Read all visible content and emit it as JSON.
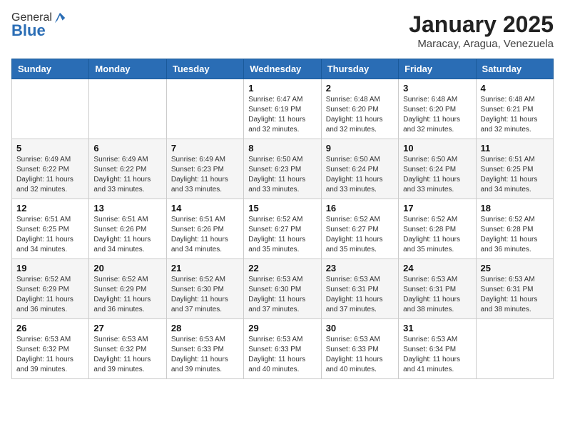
{
  "header": {
    "logo_general": "General",
    "logo_blue": "Blue",
    "title": "January 2025",
    "subtitle": "Maracay, Aragua, Venezuela"
  },
  "days_of_week": [
    "Sunday",
    "Monday",
    "Tuesday",
    "Wednesday",
    "Thursday",
    "Friday",
    "Saturday"
  ],
  "weeks": [
    [
      {
        "day": "",
        "info": ""
      },
      {
        "day": "",
        "info": ""
      },
      {
        "day": "",
        "info": ""
      },
      {
        "day": "1",
        "info": "Sunrise: 6:47 AM\nSunset: 6:19 PM\nDaylight: 11 hours and 32 minutes."
      },
      {
        "day": "2",
        "info": "Sunrise: 6:48 AM\nSunset: 6:20 PM\nDaylight: 11 hours and 32 minutes."
      },
      {
        "day": "3",
        "info": "Sunrise: 6:48 AM\nSunset: 6:20 PM\nDaylight: 11 hours and 32 minutes."
      },
      {
        "day": "4",
        "info": "Sunrise: 6:48 AM\nSunset: 6:21 PM\nDaylight: 11 hours and 32 minutes."
      }
    ],
    [
      {
        "day": "5",
        "info": "Sunrise: 6:49 AM\nSunset: 6:22 PM\nDaylight: 11 hours and 32 minutes."
      },
      {
        "day": "6",
        "info": "Sunrise: 6:49 AM\nSunset: 6:22 PM\nDaylight: 11 hours and 33 minutes."
      },
      {
        "day": "7",
        "info": "Sunrise: 6:49 AM\nSunset: 6:23 PM\nDaylight: 11 hours and 33 minutes."
      },
      {
        "day": "8",
        "info": "Sunrise: 6:50 AM\nSunset: 6:23 PM\nDaylight: 11 hours and 33 minutes."
      },
      {
        "day": "9",
        "info": "Sunrise: 6:50 AM\nSunset: 6:24 PM\nDaylight: 11 hours and 33 minutes."
      },
      {
        "day": "10",
        "info": "Sunrise: 6:50 AM\nSunset: 6:24 PM\nDaylight: 11 hours and 33 minutes."
      },
      {
        "day": "11",
        "info": "Sunrise: 6:51 AM\nSunset: 6:25 PM\nDaylight: 11 hours and 34 minutes."
      }
    ],
    [
      {
        "day": "12",
        "info": "Sunrise: 6:51 AM\nSunset: 6:25 PM\nDaylight: 11 hours and 34 minutes."
      },
      {
        "day": "13",
        "info": "Sunrise: 6:51 AM\nSunset: 6:26 PM\nDaylight: 11 hours and 34 minutes."
      },
      {
        "day": "14",
        "info": "Sunrise: 6:51 AM\nSunset: 6:26 PM\nDaylight: 11 hours and 34 minutes."
      },
      {
        "day": "15",
        "info": "Sunrise: 6:52 AM\nSunset: 6:27 PM\nDaylight: 11 hours and 35 minutes."
      },
      {
        "day": "16",
        "info": "Sunrise: 6:52 AM\nSunset: 6:27 PM\nDaylight: 11 hours and 35 minutes."
      },
      {
        "day": "17",
        "info": "Sunrise: 6:52 AM\nSunset: 6:28 PM\nDaylight: 11 hours and 35 minutes."
      },
      {
        "day": "18",
        "info": "Sunrise: 6:52 AM\nSunset: 6:28 PM\nDaylight: 11 hours and 36 minutes."
      }
    ],
    [
      {
        "day": "19",
        "info": "Sunrise: 6:52 AM\nSunset: 6:29 PM\nDaylight: 11 hours and 36 minutes."
      },
      {
        "day": "20",
        "info": "Sunrise: 6:52 AM\nSunset: 6:29 PM\nDaylight: 11 hours and 36 minutes."
      },
      {
        "day": "21",
        "info": "Sunrise: 6:52 AM\nSunset: 6:30 PM\nDaylight: 11 hours and 37 minutes."
      },
      {
        "day": "22",
        "info": "Sunrise: 6:53 AM\nSunset: 6:30 PM\nDaylight: 11 hours and 37 minutes."
      },
      {
        "day": "23",
        "info": "Sunrise: 6:53 AM\nSunset: 6:31 PM\nDaylight: 11 hours and 37 minutes."
      },
      {
        "day": "24",
        "info": "Sunrise: 6:53 AM\nSunset: 6:31 PM\nDaylight: 11 hours and 38 minutes."
      },
      {
        "day": "25",
        "info": "Sunrise: 6:53 AM\nSunset: 6:31 PM\nDaylight: 11 hours and 38 minutes."
      }
    ],
    [
      {
        "day": "26",
        "info": "Sunrise: 6:53 AM\nSunset: 6:32 PM\nDaylight: 11 hours and 39 minutes."
      },
      {
        "day": "27",
        "info": "Sunrise: 6:53 AM\nSunset: 6:32 PM\nDaylight: 11 hours and 39 minutes."
      },
      {
        "day": "28",
        "info": "Sunrise: 6:53 AM\nSunset: 6:33 PM\nDaylight: 11 hours and 39 minutes."
      },
      {
        "day": "29",
        "info": "Sunrise: 6:53 AM\nSunset: 6:33 PM\nDaylight: 11 hours and 40 minutes."
      },
      {
        "day": "30",
        "info": "Sunrise: 6:53 AM\nSunset: 6:33 PM\nDaylight: 11 hours and 40 minutes."
      },
      {
        "day": "31",
        "info": "Sunrise: 6:53 AM\nSunset: 6:34 PM\nDaylight: 11 hours and 41 minutes."
      },
      {
        "day": "",
        "info": ""
      }
    ]
  ]
}
